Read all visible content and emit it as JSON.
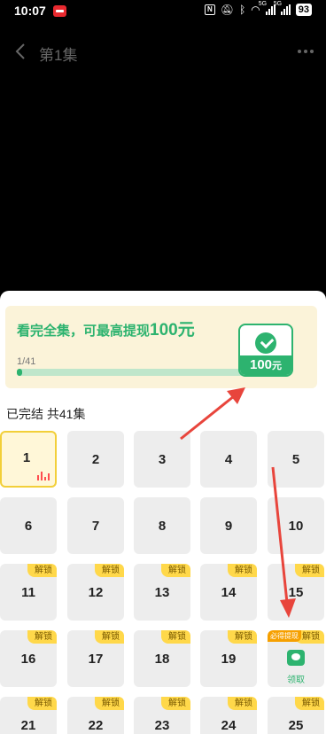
{
  "status_bar": {
    "time": "10:07",
    "battery": "93",
    "network_1": "5G",
    "network_2": "5G"
  },
  "header": {
    "title": "第1集"
  },
  "reward": {
    "title_prefix": "看完全集，可最高提现",
    "title_amount": "100元",
    "progress_text": "1/41",
    "progress_fraction": 0.024,
    "cash_value": "100",
    "cash_unit": "元"
  },
  "section": {
    "title": "已完结 共41集"
  },
  "episodes": [
    {
      "num": "1",
      "state": "current"
    },
    {
      "num": "2",
      "state": "free"
    },
    {
      "num": "3",
      "state": "free"
    },
    {
      "num": "4",
      "state": "free"
    },
    {
      "num": "5",
      "state": "free"
    },
    {
      "num": "6",
      "state": "free"
    },
    {
      "num": "7",
      "state": "free"
    },
    {
      "num": "8",
      "state": "free"
    },
    {
      "num": "9",
      "state": "free"
    },
    {
      "num": "10",
      "state": "free"
    },
    {
      "num": "11",
      "state": "locked",
      "tag": "解锁"
    },
    {
      "num": "12",
      "state": "locked",
      "tag": "解锁"
    },
    {
      "num": "13",
      "state": "locked",
      "tag": "解锁"
    },
    {
      "num": "14",
      "state": "locked",
      "tag": "解锁"
    },
    {
      "num": "15",
      "state": "locked",
      "tag": "解锁"
    },
    {
      "num": "16",
      "state": "locked",
      "tag": "解锁"
    },
    {
      "num": "17",
      "state": "locked",
      "tag": "解锁"
    },
    {
      "num": "18",
      "state": "locked",
      "tag": "解锁"
    },
    {
      "num": "19",
      "state": "locked",
      "tag": "解锁"
    },
    {
      "num": "",
      "state": "reward",
      "tag": "解锁",
      "badge": "必得提现",
      "claim_label": "领取"
    },
    {
      "num": "21",
      "state": "locked",
      "tag": "解锁"
    },
    {
      "num": "22",
      "state": "locked",
      "tag": "解锁"
    },
    {
      "num": "23",
      "state": "locked",
      "tag": "解锁"
    },
    {
      "num": "24",
      "state": "locked",
      "tag": "解锁"
    },
    {
      "num": "25",
      "state": "locked",
      "tag": "解锁"
    }
  ],
  "colors": {
    "accent_green": "#2db36f",
    "tag_yellow": "#ffd84a",
    "arrow_red": "#e8453c"
  }
}
